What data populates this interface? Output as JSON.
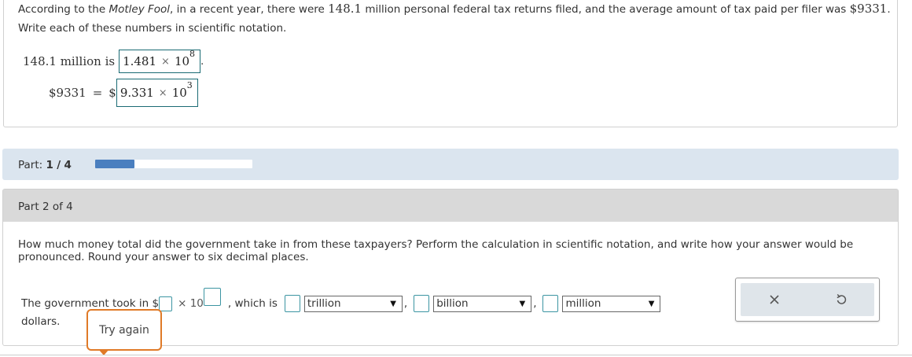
{
  "problem": {
    "intro": "According to the ",
    "source": "Motley Fool",
    "text_a": ", in a recent year, there were ",
    "filers": "148.1",
    "text_b": " million personal federal tax returns filed, and the average amount of tax paid per filer was ",
    "avg_tax": "$9331",
    "text_c": ". Write each of these numbers in scientific notation."
  },
  "line1": {
    "label": "148.1 million is",
    "mantissa": "1.481",
    "times": "×",
    "base": "10",
    "exponent": "8",
    "end": "."
  },
  "line2": {
    "label": "$9331",
    "equals": "=",
    "dollar": "$",
    "mantissa": "9.331",
    "times": "×",
    "base": "10",
    "exponent": "3"
  },
  "part_bar": {
    "label": "Part:",
    "current": "1",
    "sep": "/",
    "total": "4",
    "progress": 0.25
  },
  "part2": {
    "header": "Part 2 of 4",
    "question": "How much money total did the government take in from these taxpayers? Perform the calculation in scientific notation, and write how your answer would be pronounced. Round your answer to six decimal places.",
    "answer_prefix": "The government took in $",
    "times": "× 10",
    "which_is": ", which is",
    "comma": ",",
    "select_trillion": "trillion",
    "select_billion": "billion",
    "select_million": "million",
    "suffix": "dollars.",
    "tooltip": "Try again"
  },
  "colors": {
    "accent": "#4a7fbf",
    "input_border": "#3c95a2",
    "tooltip_border": "#e07a27",
    "part_bar_bg": "#dbe5ef"
  }
}
